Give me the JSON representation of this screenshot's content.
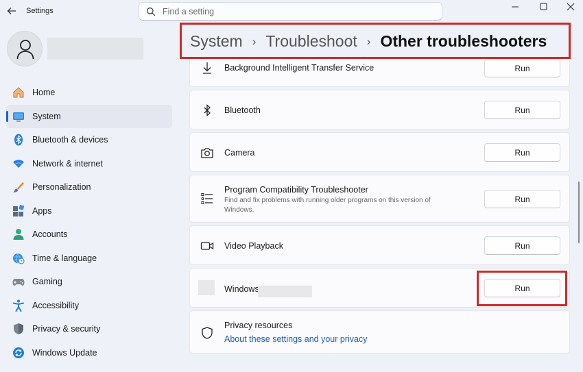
{
  "app": {
    "title": "Settings"
  },
  "search": {
    "placeholder": "Find a setting"
  },
  "breadcrumb": {
    "items": [
      "System",
      "Troubleshoot"
    ],
    "current": "Other troubleshooters"
  },
  "sidebar": {
    "items": [
      {
        "label": "Home",
        "icon": "home-icon"
      },
      {
        "label": "System",
        "icon": "system-icon"
      },
      {
        "label": "Bluetooth & devices",
        "icon": "bluetooth-icon"
      },
      {
        "label": "Network & internet",
        "icon": "wifi-icon"
      },
      {
        "label": "Personalization",
        "icon": "brush-icon"
      },
      {
        "label": "Apps",
        "icon": "apps-icon"
      },
      {
        "label": "Accounts",
        "icon": "account-icon"
      },
      {
        "label": "Time & language",
        "icon": "globe-clock-icon"
      },
      {
        "label": "Gaming",
        "icon": "gamepad-icon"
      },
      {
        "label": "Accessibility",
        "icon": "accessibility-icon"
      },
      {
        "label": "Privacy & security",
        "icon": "shield-icon"
      },
      {
        "label": "Windows Update",
        "icon": "update-icon"
      }
    ],
    "active": "System"
  },
  "troubleshooters": [
    {
      "title": "Background Intelligent Transfer Service",
      "icon": "download-icon",
      "button": "Run"
    },
    {
      "title": "Bluetooth",
      "icon": "bluetooth-icon",
      "button": "Run"
    },
    {
      "title": "Camera",
      "icon": "camera-icon",
      "button": "Run"
    },
    {
      "title": "Program Compatibility Troubleshooter",
      "description": "Find and fix problems with running older programs on this version of Windows.",
      "icon": "list-icon",
      "button": "Run"
    },
    {
      "title": "Video Playback",
      "icon": "video-icon",
      "button": "Run"
    },
    {
      "title": "Windows",
      "icon": "redacted-icon",
      "button": "Run"
    }
  ],
  "privacy": {
    "title": "Privacy resources",
    "link": "About these settings and your privacy",
    "icon": "shield-icon"
  },
  "colors": {
    "accent": "#1b63c9",
    "highlight": "#cc2a2a",
    "link": "#1a5fb4"
  }
}
